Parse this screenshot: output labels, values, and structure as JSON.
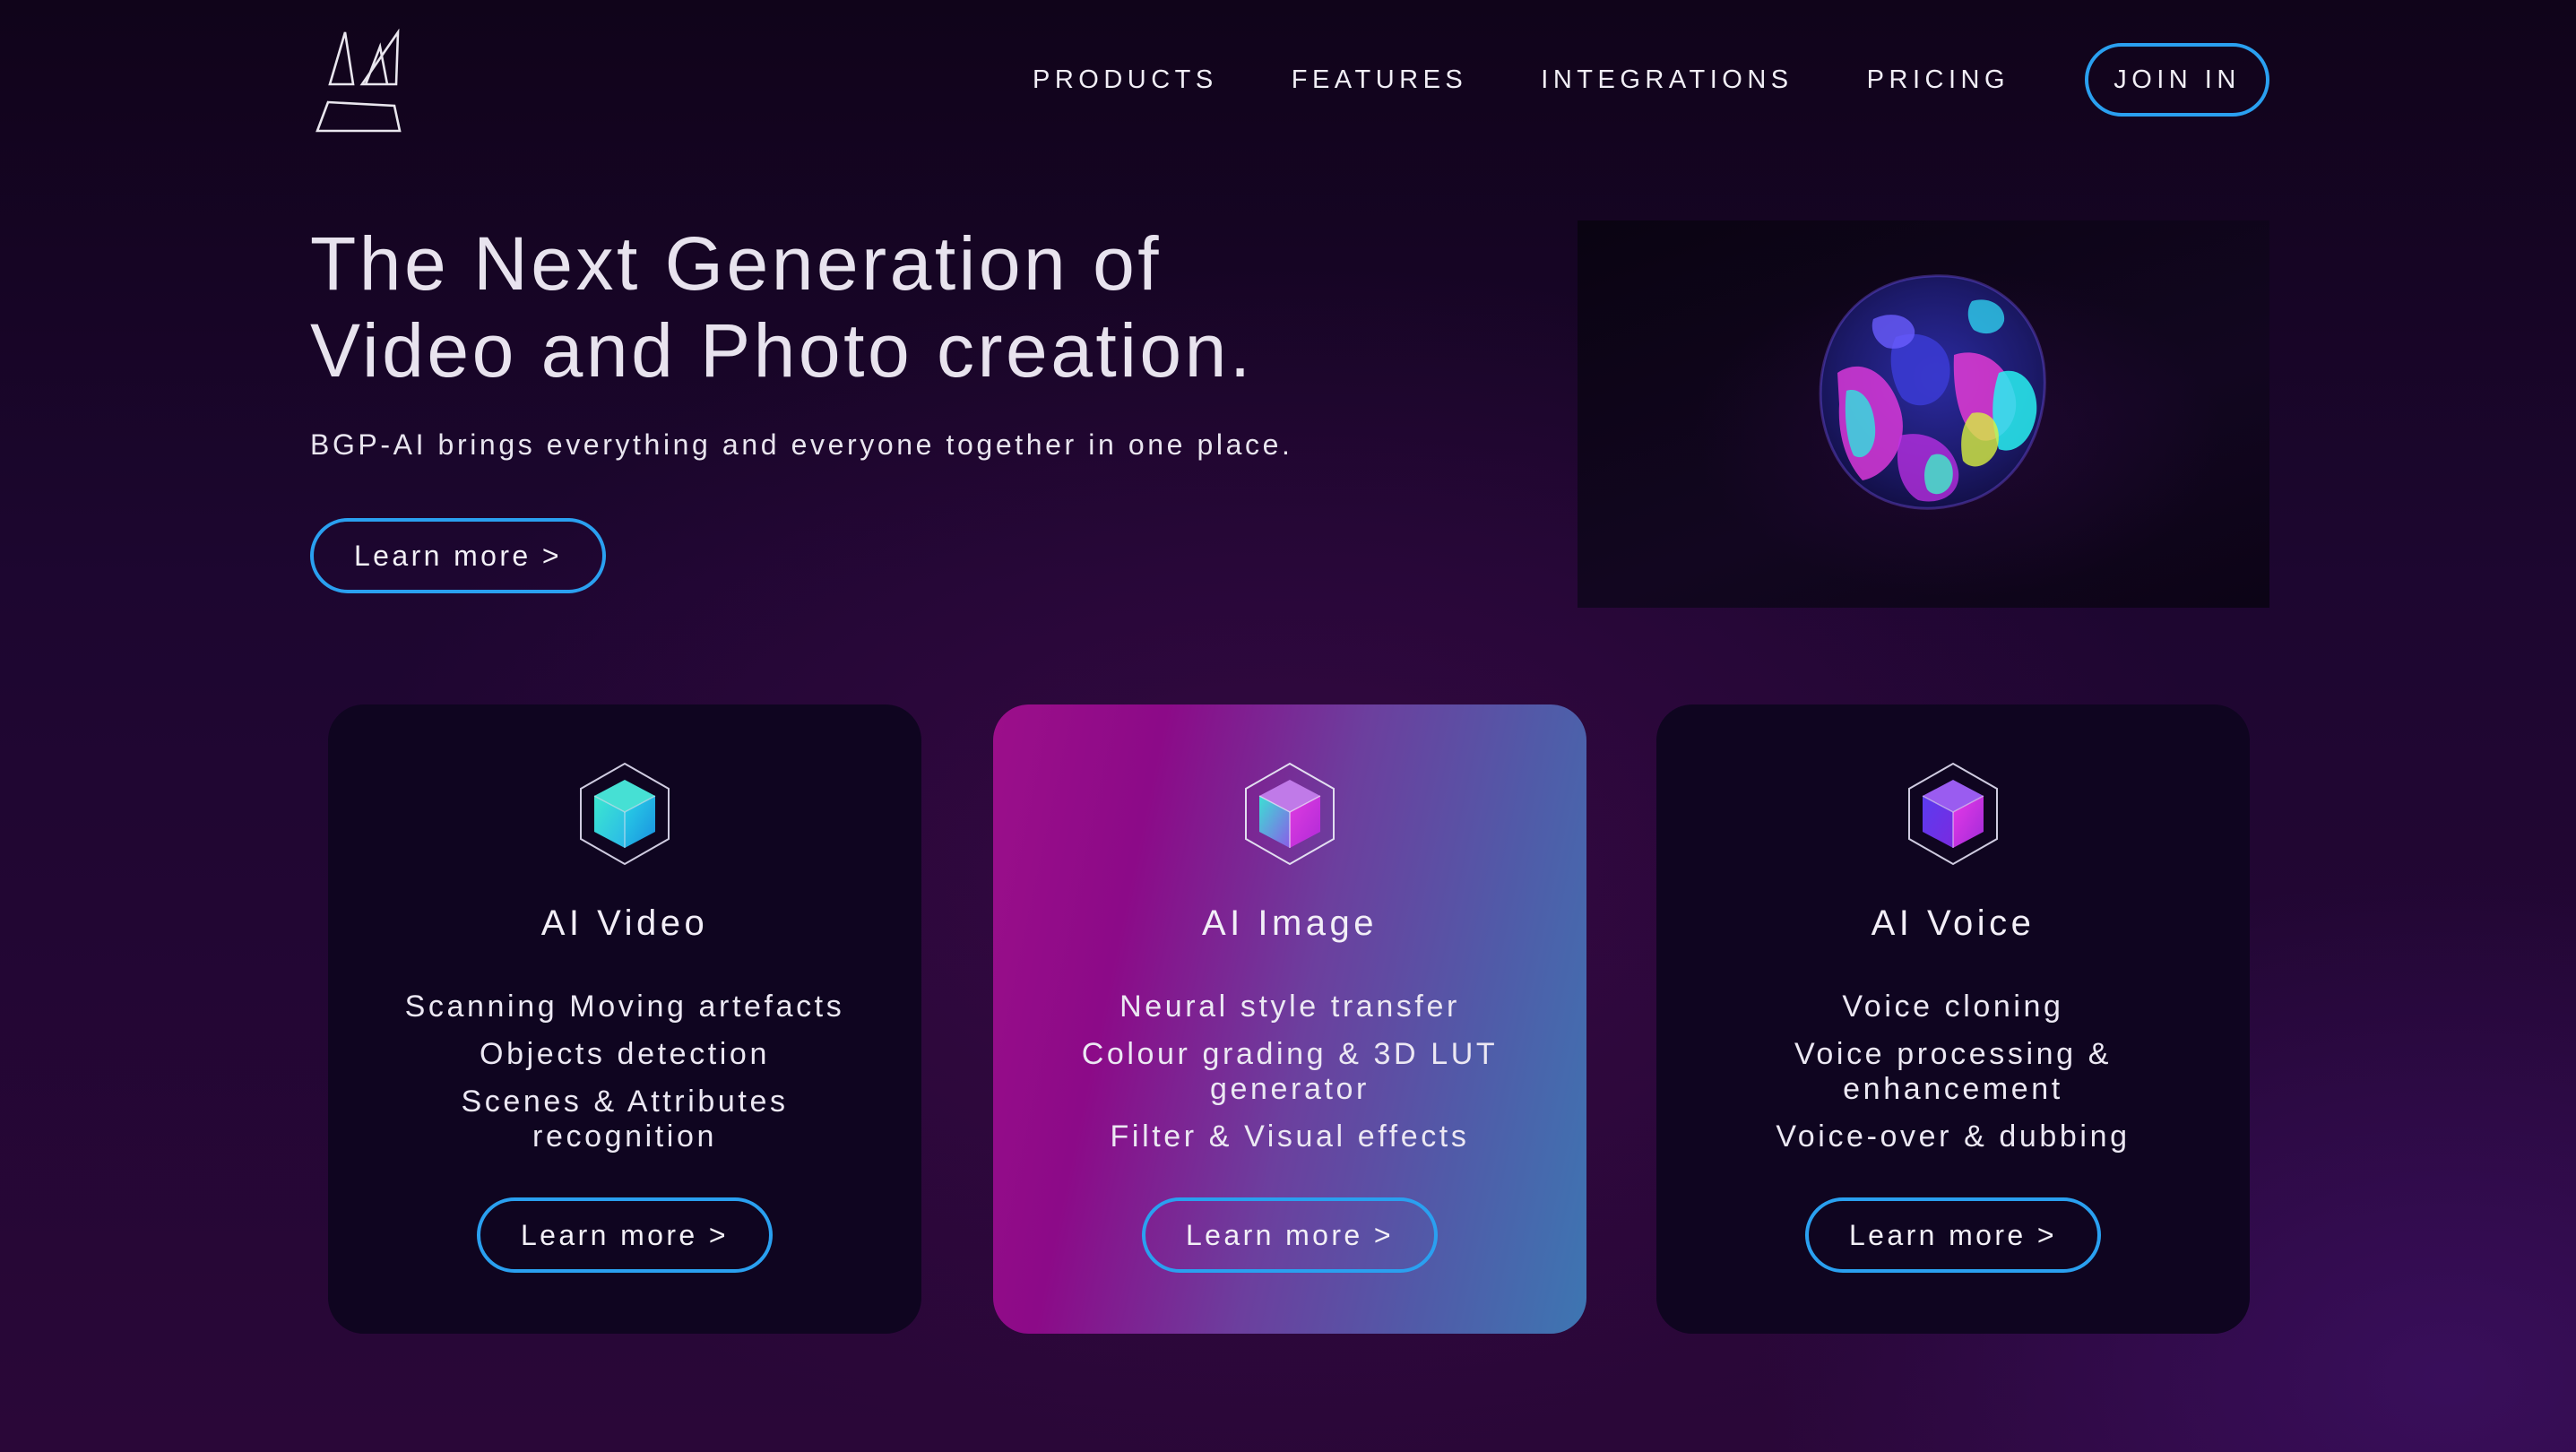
{
  "brand": {
    "logo_icon": "abstract-a-logo-icon"
  },
  "nav": {
    "items": [
      {
        "label": "PRODUCTS"
      },
      {
        "label": "FEATURES"
      },
      {
        "label": "INTEGRATIONS"
      },
      {
        "label": "PRICING"
      }
    ],
    "join_label": "JOIN IN"
  },
  "hero": {
    "title_line1": "The Next Generation of",
    "title_line2": "Video and Photo creation.",
    "subtitle": "BGP-AI brings everything and everyone together in one place.",
    "cta_label": "Learn more >",
    "media_icon": "iridescent-blob-image"
  },
  "cards": [
    {
      "icon": "cube-icon",
      "title": "AI Video",
      "features": [
        "Scanning Moving artefacts",
        "Objects detection",
        "Scenes & Attributes recognition"
      ],
      "cta_label": "Learn more >"
    },
    {
      "icon": "cube-icon",
      "title": "AI Image",
      "features": [
        "Neural style transfer",
        "Colour grading & 3D LUT generator",
        "Filter & Visual effects"
      ],
      "cta_label": "Learn more >"
    },
    {
      "icon": "cube-icon",
      "title": "AI Voice",
      "features": [
        "Voice cloning",
        "Voice processing & enhancement",
        "Voice-over & dubbing"
      ],
      "cta_label": "Learn more >"
    }
  ],
  "colors": {
    "accent_border": "#2aa0f0",
    "background_dark": "#10041a",
    "card_dark": "#0f0520",
    "feature_gradient_start": "#9c0f8a",
    "feature_gradient_end": "#3d76b2",
    "text": "#ece8f2"
  }
}
